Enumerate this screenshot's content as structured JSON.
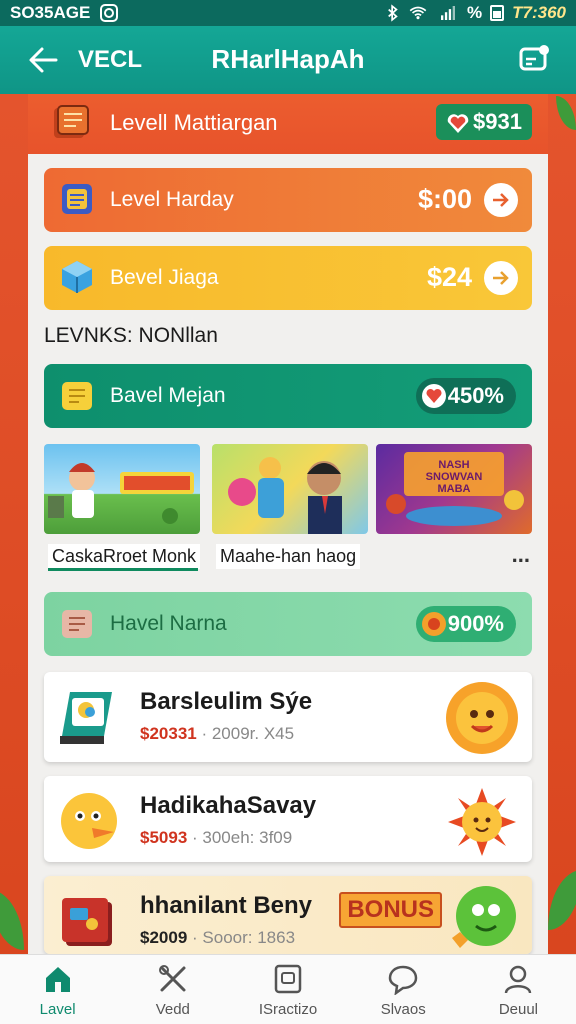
{
  "status_bar": {
    "left_text": "SO35AGE",
    "time": "T7:360",
    "battery_text": "%"
  },
  "app_bar": {
    "back_label": "VECL",
    "title": "RHarlHapAh"
  },
  "header": {
    "title": "Levell Mattiargan",
    "badge_value": "$931"
  },
  "levels": [
    {
      "label": "Level Harday",
      "price": "$:00"
    },
    {
      "label": "Bevel Jiaga",
      "price": "$24"
    }
  ],
  "section_label": "LEVNKS: NONllan",
  "promo_rows": [
    {
      "label": "Bavel Mejan",
      "value": "450%"
    },
    {
      "label": "Havel Narna",
      "value": "900%"
    }
  ],
  "thumbnails": [
    {
      "caption": "CaskaRroet Monk",
      "art_text": ""
    },
    {
      "caption": "Maahe-han haog",
      "art_text": ""
    },
    {
      "caption": "",
      "art_text": "NASH SNOWVAN MABA"
    }
  ],
  "more_label": "...",
  "cards": [
    {
      "title": "Barsleulim Sýe",
      "price": "$20331",
      "sub": "· 2009r. X45"
    },
    {
      "title": "HadikahaSavay",
      "price": "$5093",
      "sub": "· 300eh: 3f09"
    },
    {
      "title": "hhanilant Beny",
      "price": "$2009",
      "sub": "· Sooor: 1863",
      "tag": "BONUS"
    }
  ],
  "bottom_nav": [
    {
      "label": "Lavel",
      "icon": "home-icon",
      "active": true
    },
    {
      "label": "Vedd",
      "icon": "tools-icon",
      "active": false
    },
    {
      "label": "ISractizo",
      "icon": "frame-icon",
      "active": false
    },
    {
      "label": "Slvaos",
      "icon": "chat-icon",
      "active": false
    },
    {
      "label": "Deuul",
      "icon": "profile-icon",
      "active": false
    }
  ],
  "colors": {
    "teal": "#14a796",
    "orange": "#ee6a33",
    "yellow": "#f8b92b",
    "green": "#0e8f6d",
    "mint": "#7dd3a1",
    "red_bg": "#e8502c"
  }
}
